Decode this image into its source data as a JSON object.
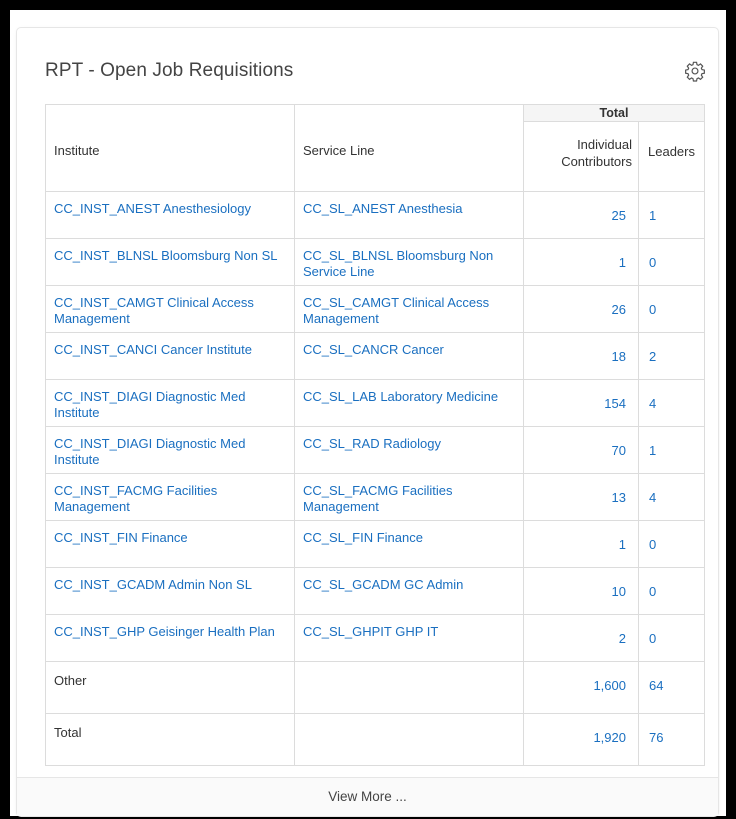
{
  "card": {
    "title": "RPT - Open Job Requisitions",
    "footer_label": "View More ..."
  },
  "icons": {
    "settings": "gear-icon"
  },
  "colors": {
    "link": "#1a6fc0",
    "border": "#dcdcdc",
    "header_bg": "#f5f5f5"
  },
  "table": {
    "group_header": "Total",
    "columns": {
      "institute": "Institute",
      "service_line": "Service Line",
      "individual": "Individual Contributors",
      "leaders": "Leaders"
    },
    "rows": [
      {
        "institute": "CC_INST_ANEST Anesthesiology",
        "service_line": "CC_SL_ANEST Anesthesia",
        "individual": "25",
        "leaders": "1"
      },
      {
        "institute": "CC_INST_BLNSL Bloomsburg Non SL",
        "service_line": "CC_SL_BLNSL Bloomsburg Non Service Line",
        "individual": "1",
        "leaders": "0"
      },
      {
        "institute": "CC_INST_CAMGT Clinical Access Management",
        "service_line": "CC_SL_CAMGT Clinical Access Management",
        "individual": "26",
        "leaders": "0"
      },
      {
        "institute": "CC_INST_CANCI Cancer Institute",
        "service_line": "CC_SL_CANCR Cancer",
        "individual": "18",
        "leaders": "2"
      },
      {
        "institute": "CC_INST_DIAGI Diagnostic Med Institute",
        "service_line": "CC_SL_LAB Laboratory Medicine",
        "individual": "154",
        "leaders": "4"
      },
      {
        "institute": "CC_INST_DIAGI Diagnostic Med Institute",
        "service_line": "CC_SL_RAD Radiology",
        "individual": "70",
        "leaders": "1"
      },
      {
        "institute": "CC_INST_FACMG Facilities Management",
        "service_line": "CC_SL_FACMG Facilities Management",
        "individual": "13",
        "leaders": "4"
      },
      {
        "institute": "CC_INST_FIN Finance",
        "service_line": "CC_SL_FIN Finance",
        "individual": "1",
        "leaders": "0"
      },
      {
        "institute": "CC_INST_GCADM Admin Non SL",
        "service_line": "CC_SL_GCADM GC Admin",
        "individual": "10",
        "leaders": "0"
      },
      {
        "institute": "CC_INST_GHP Geisinger Health Plan",
        "service_line": "CC_SL_GHPIT GHP IT",
        "individual": "2",
        "leaders": "0"
      }
    ],
    "other": {
      "label": "Other",
      "individual": "1,600",
      "leaders": "64"
    },
    "total": {
      "label": "Total",
      "individual": "1,920",
      "leaders": "76"
    }
  }
}
